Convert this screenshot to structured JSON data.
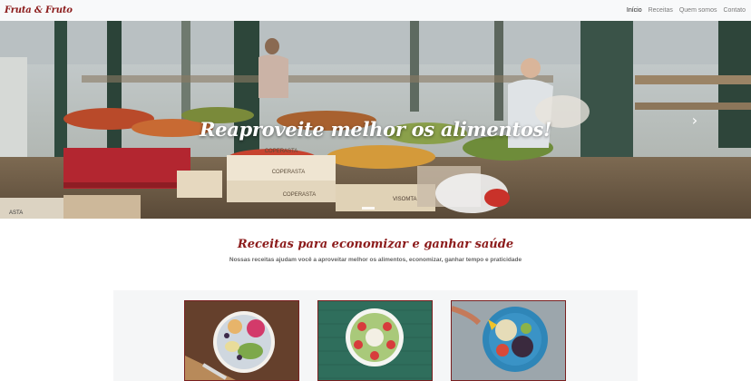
{
  "navbar": {
    "brand": "Fruta & Fruto",
    "links": [
      {
        "label": "Início",
        "active": true
      },
      {
        "label": "Receitas",
        "active": false
      },
      {
        "label": "Quem somos",
        "active": false
      },
      {
        "label": "Contato",
        "active": false
      }
    ]
  },
  "hero": {
    "caption": "Reaproveite melhor os alimentos!",
    "next_icon": "chevron-right-icon",
    "crate_labels": [
      "COPERASTA",
      "COPERASTA",
      "COPERASTA",
      "ASTA",
      "VISOMTA"
    ]
  },
  "recipes": {
    "title": "Receitas para economizar e ganhar saúde",
    "subtitle": "Nossas receitas ajudam você a aproveitar melhor os alimentos, economizar, ganhar tempo e praticidade"
  },
  "colors": {
    "brand": "#8b1a1a",
    "navbar_bg": "#f8f9fa",
    "card_border": "#7a2020"
  }
}
